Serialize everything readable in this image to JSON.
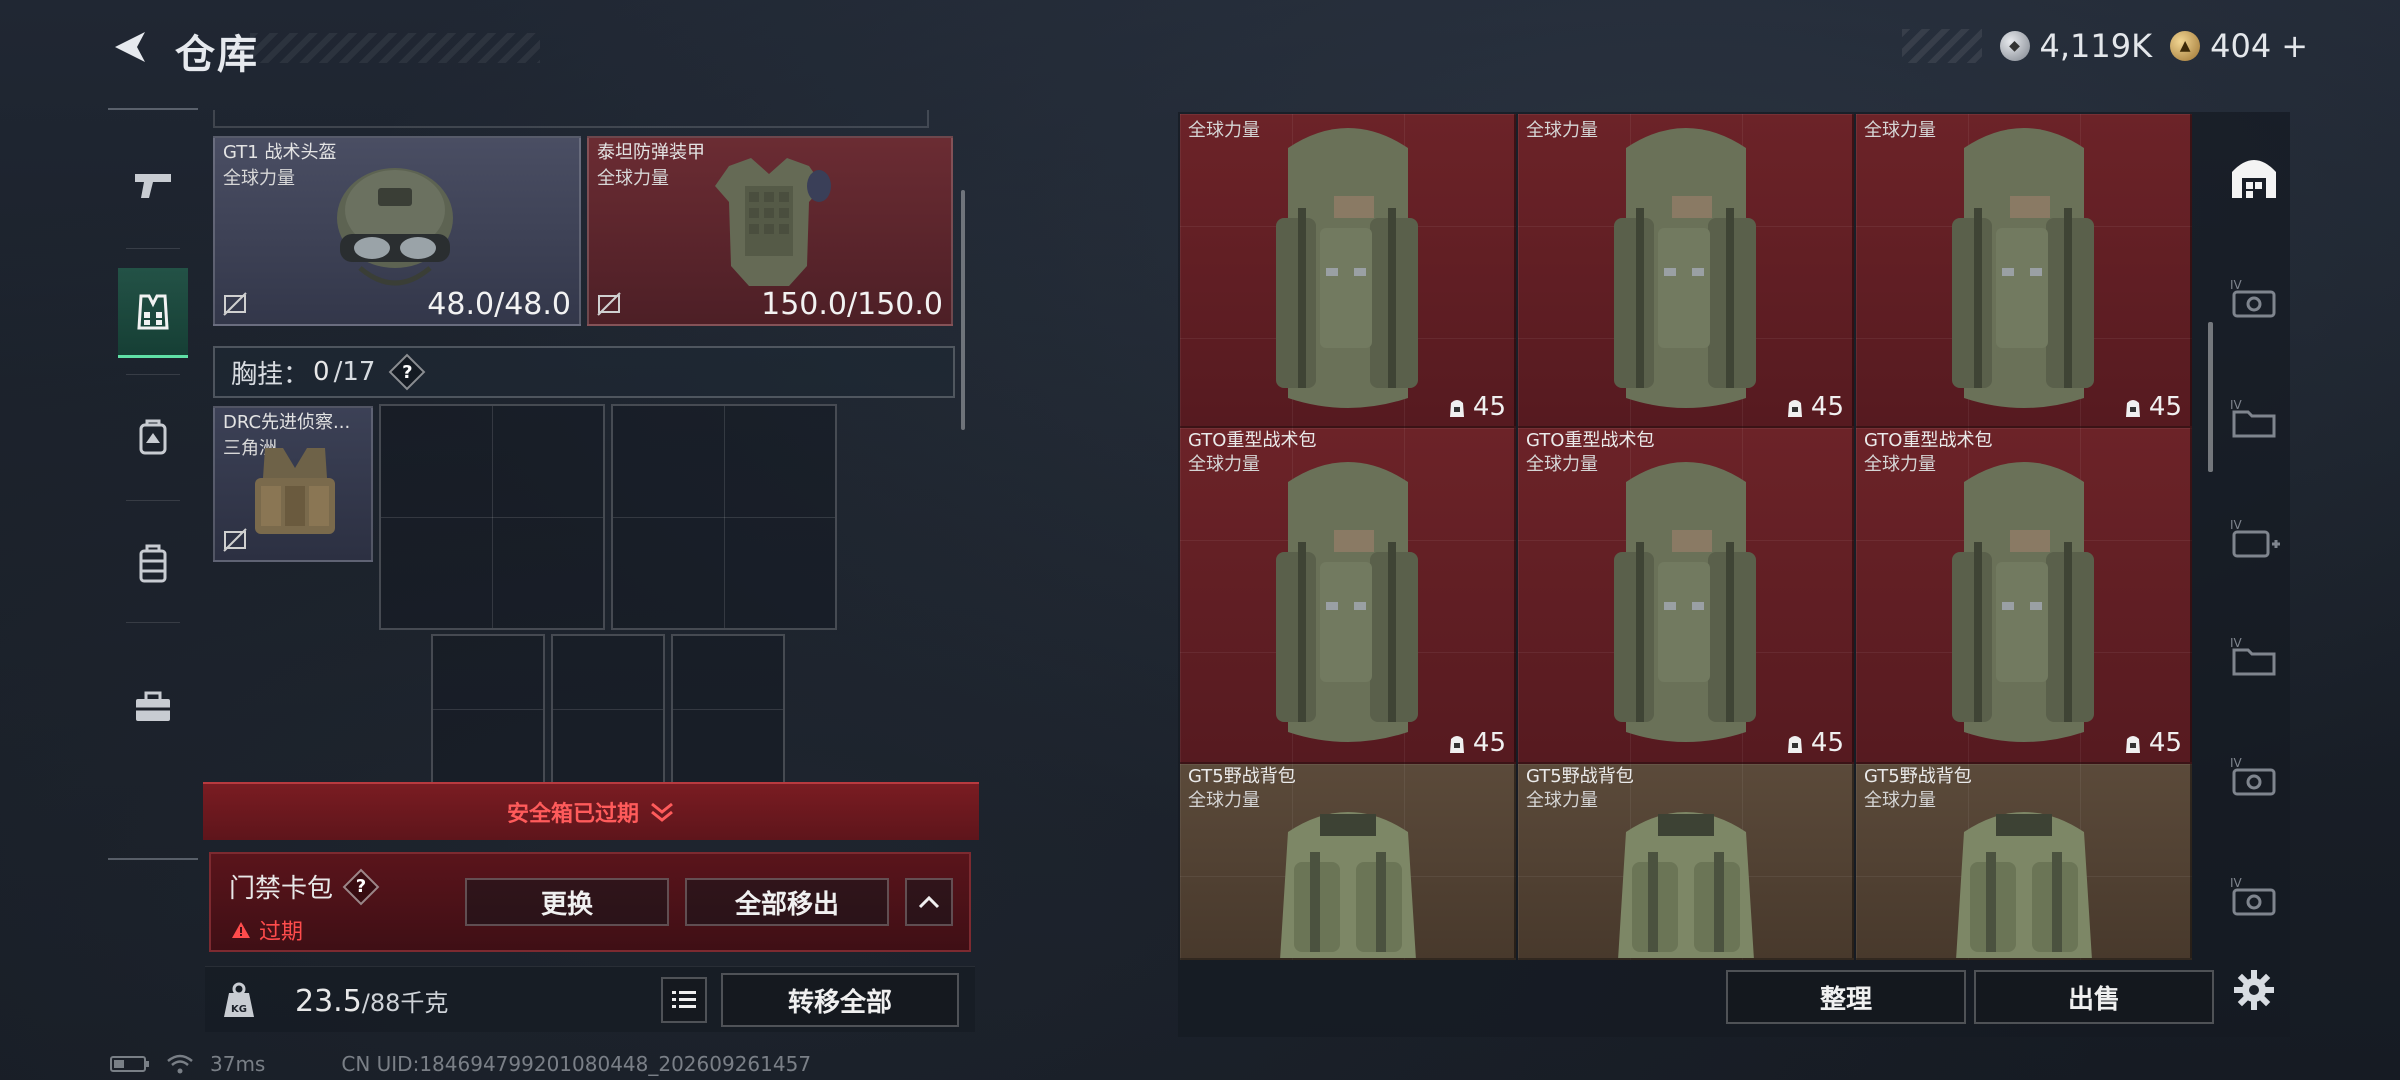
{
  "header": {
    "title": "仓库",
    "currency_silver": "4,119K",
    "currency_gold": "404",
    "currency_gold_plus": "+"
  },
  "nav": {
    "items": [
      "weapons-icon",
      "vest-icon",
      "helmet-bag-icon",
      "backpack-icon",
      "toolbox-icon"
    ],
    "active_index": 1
  },
  "equipment": {
    "helmet": {
      "name": "GT1 战术头盔",
      "sub": "全球力量",
      "durability": "48.0/48.0"
    },
    "armor": {
      "name": "泰坦防弹装甲",
      "sub": "全球力量",
      "durability": "150.0/150.0"
    },
    "vest_label": "胸挂：",
    "vest_count": "0",
    "vest_capacity": "/17",
    "help": "?",
    "rig": {
      "name": "DRC先进侦察...",
      "sub": "三角洲"
    }
  },
  "safe_box": {
    "label": "安全箱已过期"
  },
  "card_pack": {
    "title": "门禁卡包",
    "help": "?",
    "status": "过期",
    "replace_label": "更换",
    "remove_all_label": "全部移出"
  },
  "weight": {
    "current": "23.5",
    "max": "/88千克",
    "transfer_all_label": "转移全部"
  },
  "storage": {
    "rows": [
      [
        {
          "name": "",
          "sub": "全球力量",
          "cap": "45",
          "color": "red"
        },
        {
          "name": "",
          "sub": "全球力量",
          "cap": "45",
          "color": "red"
        },
        {
          "name": "",
          "sub": "全球力量",
          "cap": "45",
          "color": "red"
        }
      ],
      [
        {
          "name": "GTO重型战术包",
          "sub": "全球力量",
          "cap": "45",
          "color": "red"
        },
        {
          "name": "GTO重型战术包",
          "sub": "全球力量",
          "cap": "45",
          "color": "red"
        },
        {
          "name": "GTO重型战术包",
          "sub": "全球力量",
          "cap": "45",
          "color": "red"
        }
      ],
      [
        {
          "name": "GT5野战背包",
          "sub": "全球力量",
          "cap": "",
          "color": "brown"
        },
        {
          "name": "GT5野战背包",
          "sub": "全球力量",
          "cap": "",
          "color": "brown"
        },
        {
          "name": "GT5野战背包",
          "sub": "全球力量",
          "cap": "",
          "color": "brown"
        }
      ]
    ],
    "organize_label": "整理",
    "sell_label": "出售"
  },
  "status": {
    "ping": "37ms",
    "uid": "CN UID:184694799201080448_202609261457"
  },
  "colors": {
    "accent_green": "#5fe0a6",
    "warning_red": "#ff4c4c",
    "item_red": "#6c2328",
    "item_brown": "#5b4a3a"
  }
}
